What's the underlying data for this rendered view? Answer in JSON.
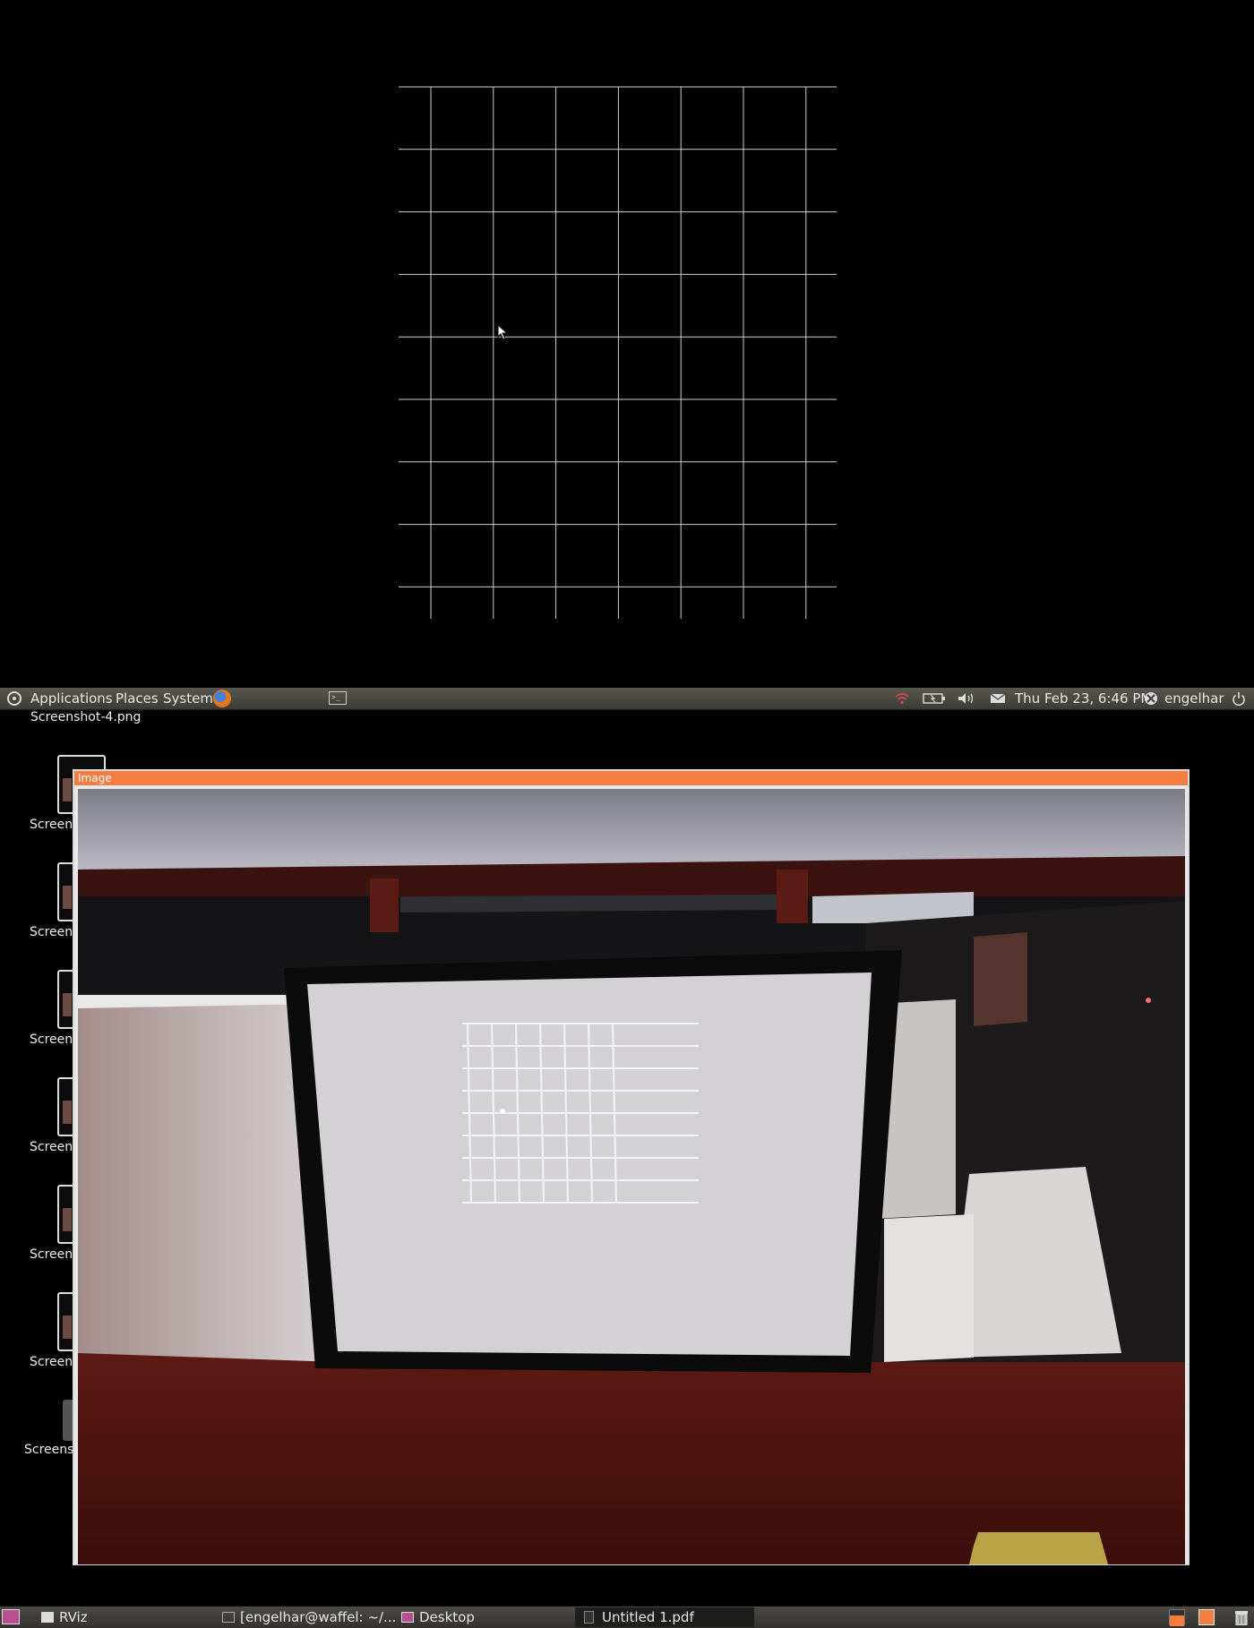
{
  "top_panel": {
    "menus": [
      "Applications",
      "Places",
      "System"
    ],
    "clock": "Thu Feb 23,  6:46 PM",
    "user": "engelhar",
    "icons": [
      "ubuntu-logo-icon",
      "firefox-icon",
      "terminal-icon",
      "wifi-icon",
      "battery-icon",
      "volume-icon",
      "mail-icon",
      "user-icon",
      "power-icon"
    ]
  },
  "desktop": {
    "filename": "Screenshot-4.png",
    "icons": [
      {
        "label": "Screens"
      },
      {
        "label": "Screens"
      },
      {
        "label": "Screens"
      },
      {
        "label": "Screens"
      },
      {
        "label": "Screens"
      },
      {
        "label": "Screens"
      },
      {
        "label": "Screens"
      }
    ]
  },
  "image_window": {
    "title": "Image"
  },
  "taskbar": {
    "items": [
      {
        "label": "RViz",
        "icon": "window-icon"
      },
      {
        "label": "[engelhar@waffel: ~/...",
        "icon": "terminal-icon"
      },
      {
        "label": "Desktop",
        "icon": "folder-icon"
      },
      {
        "label": "Untitled 1.pdf",
        "icon": "document-icon"
      }
    ],
    "colors": {
      "workspace_active": "#f47d42",
      "accent": "#f47d42"
    }
  }
}
